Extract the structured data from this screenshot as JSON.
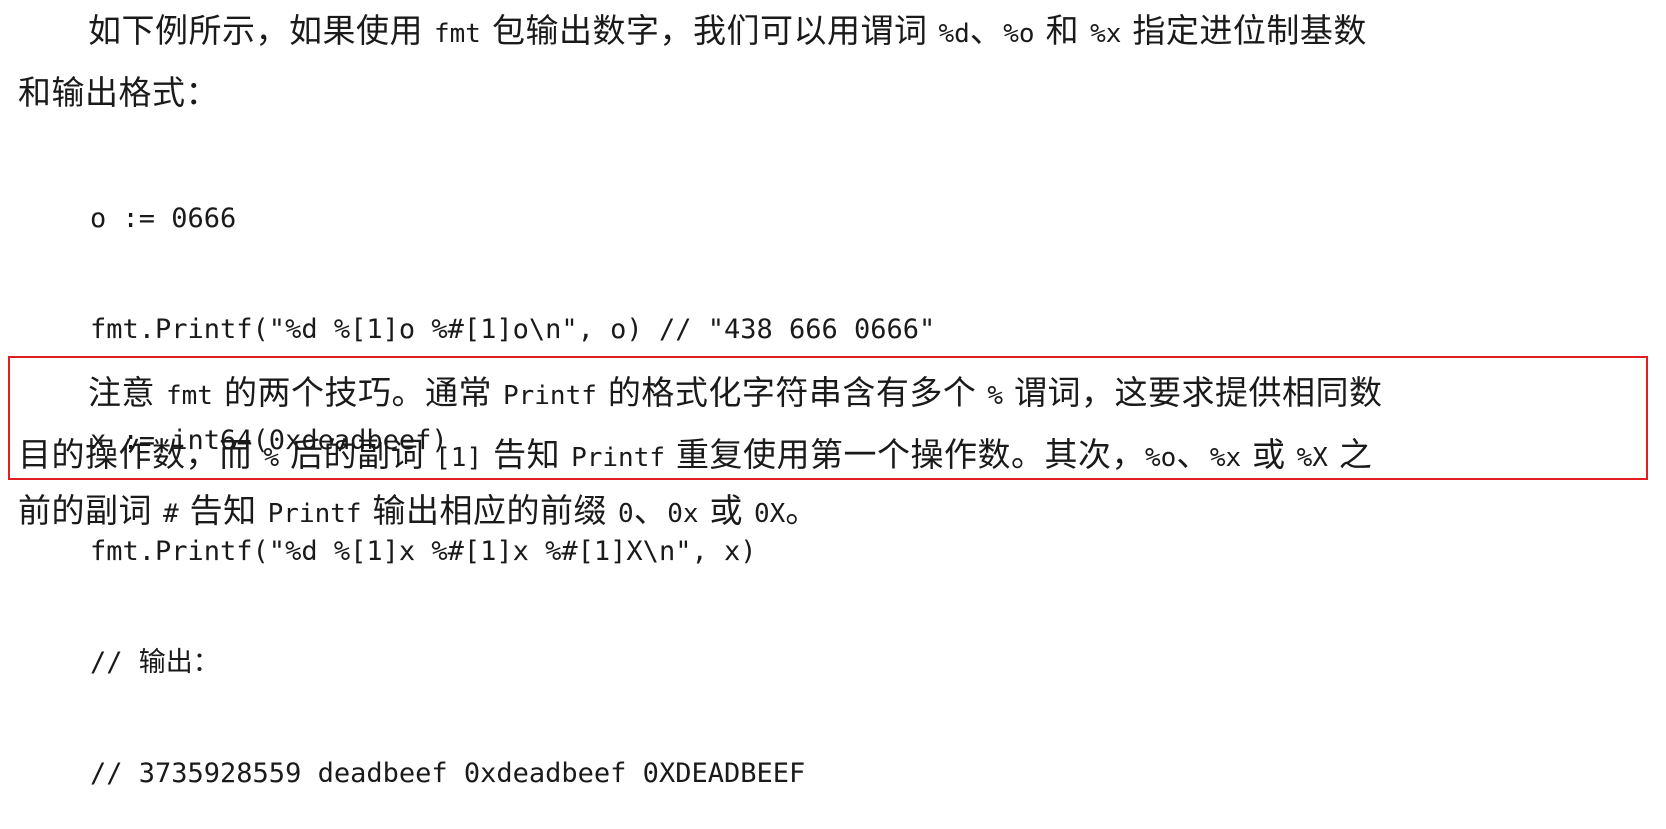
{
  "paragraph1": {
    "line1": [
      {
        "t": "如下例所示，如果使用 ",
        "mono": false
      },
      {
        "t": "fmt",
        "mono": true
      },
      {
        "t": " 包输出数字，我们可以用谓词 ",
        "mono": false
      },
      {
        "t": "%d",
        "mono": true
      },
      {
        "t": "、",
        "mono": false
      },
      {
        "t": "%o",
        "mono": true
      },
      {
        "t": " 和 ",
        "mono": false
      },
      {
        "t": "%x",
        "mono": true
      },
      {
        "t": " 指定进位制基数",
        "mono": false
      }
    ],
    "line2": [
      {
        "t": "和输出格式：",
        "mono": false
      }
    ]
  },
  "code": [
    "o := 0666",
    "fmt.Printf(\"%d %[1]o %#[1]o\\n\", o) // \"438 666 0666\"",
    "x := int64(0xdeadbeef)",
    "fmt.Printf(\"%d %[1]x %#[1]x %#[1]X\\n\", x)",
    "// 输出：",
    "// 3735928559 deadbeef 0xdeadbeef 0XDEADBEEF"
  ],
  "paragraph2": {
    "line1": [
      {
        "t": "注意 ",
        "mono": false
      },
      {
        "t": "fmt",
        "mono": true
      },
      {
        "t": " 的两个技巧。通常 ",
        "mono": false
      },
      {
        "t": "Printf",
        "mono": true
      },
      {
        "t": " 的格式化字符串含有多个 ",
        "mono": false
      },
      {
        "t": "%",
        "mono": true
      },
      {
        "t": " 谓词，这要求提供相同数",
        "mono": false
      }
    ],
    "line2": [
      {
        "t": "目的操作数，而 ",
        "mono": false
      },
      {
        "t": "%",
        "mono": true
      },
      {
        "t": " 后的副词 ",
        "mono": false
      },
      {
        "t": "[1]",
        "mono": true
      },
      {
        "t": " 告知 ",
        "mono": false
      },
      {
        "t": "Printf",
        "mono": true
      },
      {
        "t": " 重复使用第一个操作数。其次，",
        "mono": false
      },
      {
        "t": "%o",
        "mono": true
      },
      {
        "t": "、",
        "mono": false
      },
      {
        "t": "%x",
        "mono": true
      },
      {
        "t": " 或 ",
        "mono": false
      },
      {
        "t": "%X",
        "mono": true
      },
      {
        "t": " 之",
        "mono": false
      }
    ]
  },
  "paragraph3": {
    "line1": [
      {
        "t": "前的副词 ",
        "mono": false
      },
      {
        "t": "#",
        "mono": true
      },
      {
        "t": " 告知 ",
        "mono": false
      },
      {
        "t": "Printf",
        "mono": true
      },
      {
        "t": " 输出相应的前缀 ",
        "mono": false
      },
      {
        "t": "0",
        "mono": true
      },
      {
        "t": "、",
        "mono": false
      },
      {
        "t": "0x",
        "mono": true
      },
      {
        "t": " 或 ",
        "mono": false
      },
      {
        "t": "0X",
        "mono": true
      },
      {
        "t": "。",
        "mono": false
      }
    ]
  },
  "colors": {
    "highlight_border": "#e02020",
    "text": "#1a1a1a"
  }
}
